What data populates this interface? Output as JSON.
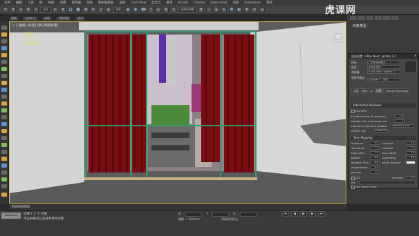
{
  "menubar": {
    "items": [
      "文件",
      "编辑",
      "工具",
      "组",
      "视图",
      "创建",
      "修改器",
      "动画",
      "图形编辑器",
      "渲染",
      "Civil View",
      "自定义",
      "脚本",
      "Arnold",
      "Corona",
      "Interactive",
      "内容",
      "Substance",
      "帮助"
    ]
  },
  "toolbar": {
    "dropdown_selection": "全部",
    "dropdown_view": "视图",
    "dropdown_named": "创建选择集"
  },
  "ribbon": {
    "items": [
      "建模",
      "自由形式",
      "选择",
      "对象绘制",
      "填充"
    ]
  },
  "viewport": {
    "label": "[+] [透视] [标准] [默认明暗处理]",
    "stats": [
      "多边形:",
      "总计",
      "16,870",
      "顶点:",
      "8,402",
      "FPS:"
    ],
    "stats_values": [
      "1,337,027",
      "1,244,809"
    ]
  },
  "command_panel": {
    "title": "对象类型"
  },
  "render_dialog": {
    "title": "渲染设置: V-Ray Next, update 1.2",
    "target_label": "目标:",
    "target_value": "产品级渲染模式",
    "preset_label": "预设:",
    "preset_value": "未选定预设",
    "renderer_label": "渲染器:",
    "renderer_value": "V-Ray Next, update 1.2",
    "view_label": "查看到渲染:",
    "view_value": "四元菜单 4 - 透视",
    "tabs": [
      "公用",
      "VRay",
      "GI",
      "设置",
      "Render Elements"
    ],
    "rollout_ir": "Interactive Renderer",
    "ir_checkbox": "Use GPU",
    "ir_rows": [
      {
        "label": "Limited sizing (0 samples)",
        "value": "1.0"
      },
      {
        "label": "Update rate frames per sec",
        "value": "1"
      },
      {
        "label": "real time geometry update",
        "value": "Geometry only"
      },
      {
        "label": "render size",
        "value": "1000x750"
      }
    ],
    "rollout_tone": "Tone Mapping",
    "tone_left": [
      {
        "label": "exposure",
        "value": "0.0"
      },
      {
        "label": "saturation",
        "value": "1.0"
      },
      {
        "label": "high contr.",
        "value": "1.0"
      },
      {
        "label": "lighten",
        "value": "0.0"
      },
      {
        "label": "shadow ↑l:m",
        "value": "0.0"
      },
      {
        "label": "image sharp.",
        "value": "0.0"
      },
      {
        "label": "gamma",
        "value": "2.2"
      }
    ],
    "tone_right": [
      {
        "label": "contrast",
        "value": "0.0"
      },
      {
        "label": "contrast",
        "value": "1.0"
      },
      {
        "label": "burn value",
        "value": "1.0"
      },
      {
        "label": "vignetting",
        "value": "0.0"
      },
      {
        "label": "white balance",
        "value": ""
      }
    ],
    "lut_label": "LUT",
    "lut_strength_label": "strength",
    "lut_strength": "1.0",
    "lut_file_label": "file",
    "lut_curve": "Use Bloom Filter"
  },
  "status": {
    "maxscript": "MAXScript",
    "selected": "选择了 1 个 对象",
    "hint": "单击并拖动以选择并移动对象",
    "coords": [
      {
        "axis": "X:",
        "value": ""
      },
      {
        "axis": "Y:",
        "value": ""
      },
      {
        "axis": "Z:",
        "value": ""
      }
    ],
    "grid": "栅格 = 10.0mm",
    "time_tag": "添加时间标记"
  },
  "watermark": "虎课网",
  "colors": {
    "viewport_border": "#e2c34a",
    "curtain_red": "#7a0d12",
    "frame_green": "#2e9e6a",
    "stats_yellow": "#e7e34a"
  }
}
